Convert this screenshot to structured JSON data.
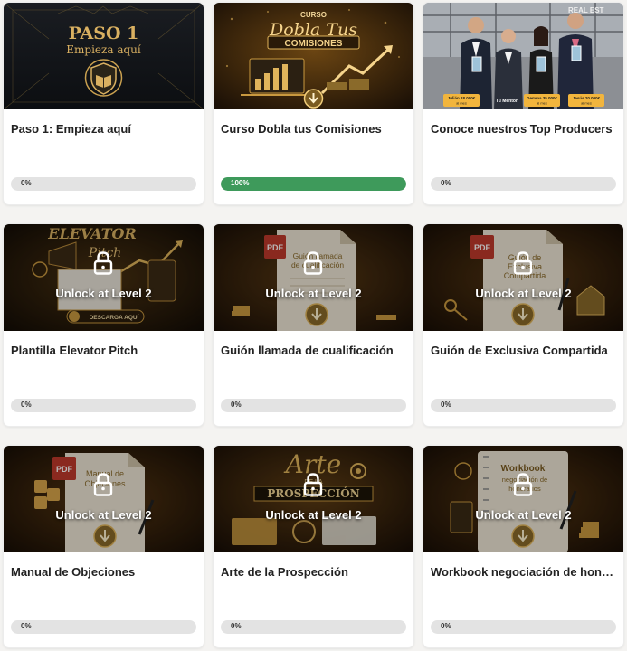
{
  "lock_label": "Unlock at Level 2",
  "courses": [
    {
      "title": "Paso 1: Empieza aquí",
      "progress_percent": 0,
      "progress_label": "0%",
      "locked": false,
      "thumb": {
        "line1": "PASO 1",
        "line2": "Empieza aquí"
      }
    },
    {
      "title": "Curso Dobla tus Comisiones",
      "progress_percent": 100,
      "progress_label": "100%",
      "locked": false,
      "thumb": {
        "line1": "CURSO",
        "line2": "Dobla Tus",
        "line3": "COMISIONES"
      }
    },
    {
      "title": "Conoce nuestros Top Producers",
      "progress_percent": 0,
      "progress_label": "0%",
      "locked": false,
      "thumb": {
        "sign": "REAL EST",
        "tags": [
          {
            "line1": "Julián 18.000€",
            "line2": "al mes"
          },
          {
            "line1": "Tu Mentor",
            "line2": ""
          },
          {
            "line1": "Gemma 35.000€",
            "line2": "al mes"
          },
          {
            "line1": "Jesús 20.000€",
            "line2": "al mes"
          }
        ]
      }
    },
    {
      "title": "Plantilla Elevator Pitch",
      "progress_percent": 0,
      "progress_label": "0%",
      "locked": true,
      "thumb": {
        "line1": "ELEVATOR",
        "line2": "Pitch",
        "button": "DESCARGA AQUÍ"
      }
    },
    {
      "title": "Guión llamada de cualificación",
      "progress_percent": 0,
      "progress_label": "0%",
      "locked": true,
      "thumb": {
        "badge": "PDF",
        "doc1": "Guión llamada",
        "doc2": "de cualificación"
      }
    },
    {
      "title": "Guión de Exclusiva Compartida",
      "progress_percent": 0,
      "progress_label": "0%",
      "locked": true,
      "thumb": {
        "badge": "PDF",
        "doc1": "Guión de",
        "doc2": "Exclusiva",
        "doc3": "Compartida"
      }
    },
    {
      "title": "Manual de Objeciones",
      "progress_percent": 0,
      "progress_label": "0%",
      "locked": true,
      "thumb": {
        "badge": "PDF",
        "doc1": "Manual de",
        "doc2": "Objeciones"
      }
    },
    {
      "title": "Arte de la Prospección",
      "progress_percent": 0,
      "progress_label": "0%",
      "locked": true,
      "thumb": {
        "line1": "Arte",
        "line2": "DE LA",
        "line3": "PROSPECCIÓN"
      }
    },
    {
      "title": "Workbook negociación de honorarios",
      "progress_percent": 0,
      "progress_label": "0%",
      "locked": true,
      "thumb": {
        "doc1": "Workbook",
        "doc2": "negociación de",
        "doc3": "honorarios"
      }
    }
  ],
  "colors": {
    "progress_fill": "#3e9a5b",
    "progress_track": "#e3e3e3",
    "gold": "#d9b061",
    "page_bg": "#f4f3f1"
  }
}
